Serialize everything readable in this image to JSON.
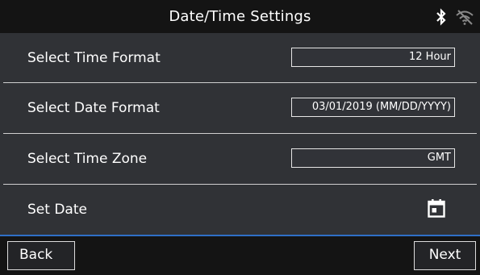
{
  "header": {
    "title": "Date/Time Settings"
  },
  "settings": [
    {
      "label": "Select Time Format",
      "value": "12 Hour"
    },
    {
      "label": "Select Date Format",
      "value": "03/01/2019 (MM/DD/YYYY)"
    },
    {
      "label": "Select Time Zone",
      "value": "GMT"
    },
    {
      "label": "Set Date"
    }
  ],
  "footer": {
    "back_label": "Back",
    "next_label": "Next"
  },
  "icons": {
    "bluetooth": "bluetooth-icon",
    "wifi": "wifi-off-icon",
    "calendar": "calendar-icon"
  },
  "colors": {
    "titlebar_bg": "#141414",
    "row_bg": "#303236",
    "accent_line": "#2f6fc7"
  }
}
